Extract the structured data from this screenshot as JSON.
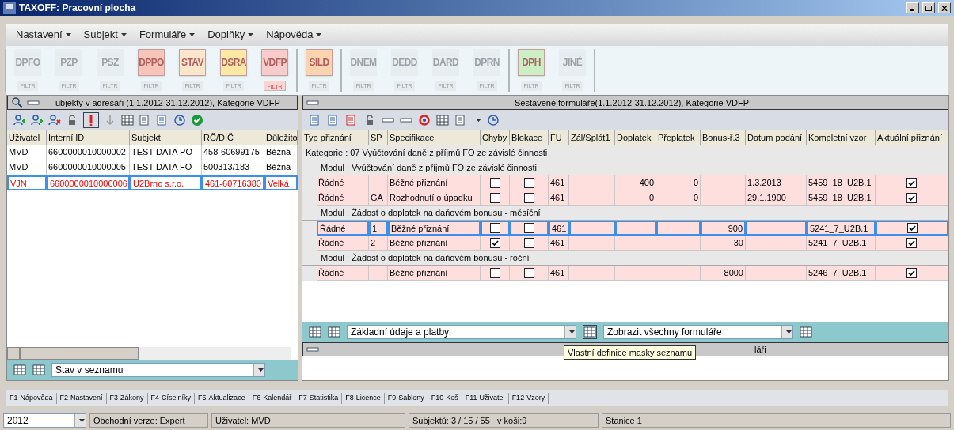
{
  "window": {
    "title": "TAXOFF: Pracovní plocha"
  },
  "menu": [
    "Nastavení",
    "Subjekt",
    "Formuláře",
    "Doplňky",
    "Nápověda"
  ],
  "form_groups": [
    [
      {
        "code": "DPFO",
        "active": false,
        "color": "#e8eef0",
        "filter_selected": false,
        "filter": "FILTR"
      },
      {
        "code": "PZP",
        "active": false,
        "color": "#e8eef0",
        "filter_selected": false,
        "filter": "FILTR"
      },
      {
        "code": "PSZ",
        "active": false,
        "color": "#e8eef0",
        "filter_selected": false,
        "filter": "FILTR"
      },
      {
        "code": "DPPO",
        "active": true,
        "color": "#f6c4b8",
        "filter_selected": false,
        "filter": "FILTR"
      },
      {
        "code": "STAV",
        "active": true,
        "color": "#fbe6cc",
        "filter_selected": false,
        "filter": "FILTR"
      },
      {
        "code": "DSRA",
        "active": true,
        "color": "#fde9a4",
        "filter_selected": false,
        "filter": "FILTR"
      },
      {
        "code": "VDFP",
        "active": true,
        "color": "#f9cccc",
        "filter_selected": true,
        "filter": "FILTR"
      }
    ],
    [
      {
        "code": "SILD",
        "active": true,
        "color": "#f9d4ae",
        "filter_selected": false,
        "filter": "FILTR"
      }
    ],
    [
      {
        "code": "DNEM",
        "active": false,
        "color": "#e8eef0",
        "filter_selected": false,
        "filter": "FILTR"
      },
      {
        "code": "DEDD",
        "active": false,
        "color": "#e8eef0",
        "filter_selected": false,
        "filter": "FILTR"
      },
      {
        "code": "DARD",
        "active": false,
        "color": "#e8eef0",
        "filter_selected": false,
        "filter": "FILTR"
      },
      {
        "code": "DPRN",
        "active": false,
        "color": "#e8eef0",
        "filter_selected": false,
        "filter": "FILTR"
      }
    ],
    [
      {
        "code": "DPH",
        "active": true,
        "color": "#cdeec4",
        "filter_selected": false,
        "filter": "FILTR"
      },
      {
        "code": "JINÉ",
        "active": false,
        "color": "#e8eef0",
        "filter_selected": false,
        "filter": "FILTR"
      }
    ]
  ],
  "subjects_panel": {
    "title": "ubjekty v adresáři (1.1.2012-31.12.2012), Kategorie VDFP",
    "columns": [
      "Uživatel",
      "Interní ID",
      "Subjekt",
      "RČ/DIČ",
      "Důležito"
    ],
    "rows": [
      {
        "cells": [
          "MVD",
          "6600000010000002",
          "TEST DATA PO",
          "458-60699175",
          "Běžná"
        ],
        "selected": false
      },
      {
        "cells": [
          "MVD",
          "6600000010000005",
          "TEST DATA FO",
          "500313/183",
          "Běžná"
        ],
        "selected": false
      },
      {
        "cells": [
          "VJN",
          "6600000010000006",
          "U2Brno s.r.o.",
          "461-60716380",
          "Velká"
        ],
        "selected": true
      }
    ],
    "filter_dropdown": "Stav v seznamu"
  },
  "forms_panel": {
    "title": "Sestavené formuláře(1.1.2012-31.12.2012), Kategorie VDFP",
    "columns": [
      "Typ přiznání",
      "SP",
      "Specifikace",
      "Chyby",
      "Blokace",
      "FU",
      "Zál/Splát1",
      "Doplatek",
      "Přeplatek",
      "Bonus-ř.3",
      "Datum podání",
      "Kompletní vzor",
      "Aktuální přiznání"
    ],
    "rows": [
      {
        "kind": "category",
        "text": "Kategorie : 07 Vyúčtování daně z příjmů FO ze závislé činnosti"
      },
      {
        "kind": "module",
        "text": "Modul : Vyúčtování daně z příjmů FO ze závislé činnosti"
      },
      {
        "kind": "form",
        "typ": "Řádné",
        "sp": "",
        "spec": "Běžné přiznání",
        "chyby": false,
        "blokace": false,
        "fu": "461",
        "zal": "",
        "doplatek": "400",
        "preplatek": "0",
        "bonus": "",
        "datum": "1.3.2013",
        "vzor": "5459_18_U2B.1",
        "aktualni": true,
        "selected": false
      },
      {
        "kind": "form",
        "typ": "Řádné",
        "sp": "GA",
        "spec": "Rozhodnutí o úpadku",
        "chyby": false,
        "blokace": false,
        "fu": "461",
        "zal": "",
        "doplatek": "0",
        "preplatek": "0",
        "bonus": "",
        "datum": "29.1.1900",
        "vzor": "5459_18_U2B.1",
        "aktualni": true,
        "selected": false
      },
      {
        "kind": "module",
        "text": "Modul : Žádost o doplatek na daňovém bonusu - měsíční"
      },
      {
        "kind": "form",
        "typ": "Řádné",
        "sp": "1",
        "spec": "Běžné přiznání",
        "chyby": false,
        "blokace": false,
        "fu": "461",
        "zal": "",
        "doplatek": "",
        "preplatek": "",
        "bonus": "900",
        "datum": "",
        "vzor": "5241_7_U2B.1",
        "aktualni": true,
        "selected": true
      },
      {
        "kind": "form",
        "typ": "Řádné",
        "sp": "2",
        "spec": "Běžné přiznání",
        "chyby": true,
        "blokace": false,
        "fu": "461",
        "zal": "",
        "doplatek": "",
        "preplatek": "",
        "bonus": "30",
        "datum": "",
        "vzor": "5241_7_U2B.1",
        "aktualni": true,
        "selected": false
      },
      {
        "kind": "module",
        "text": "Modul : Žádost o doplatek na daňovém bonusu - roční"
      },
      {
        "kind": "form",
        "typ": "Řádné",
        "sp": "",
        "spec": "Běžné přiznání",
        "chyby": false,
        "blokace": false,
        "fu": "461",
        "zal": "",
        "doplatek": "",
        "preplatek": "",
        "bonus": "8000",
        "datum": "",
        "vzor": "5246_7_U2B.1",
        "aktualni": true,
        "selected": false
      }
    ],
    "mask_dropdown": "Základní údaje a platby",
    "filter_dropdown": "Zobrazit všechny formuláře",
    "tooltip": "Vlastní definice masky seznamu"
  },
  "lower_panel": {
    "title": "láři"
  },
  "function_keys": [
    "F1-Nápověda",
    "F2-Nastavení",
    "F3-Zákony",
    "F4-Číselníky",
    "F5-Aktualizace",
    "F6-Kalendář",
    "F7-Statistika",
    "F8-Licence",
    "F9-Šablony",
    "F10-Koš",
    "F11-Uživatel",
    "F12-Vzory"
  ],
  "status_bar": {
    "year": "2012",
    "edition": "Obchodní verze: Expert",
    "user": "Uživatel: MVD",
    "subjects": "Subjektů: 3 / 15 / 55   v koši:9",
    "station": "Stanice 1"
  }
}
